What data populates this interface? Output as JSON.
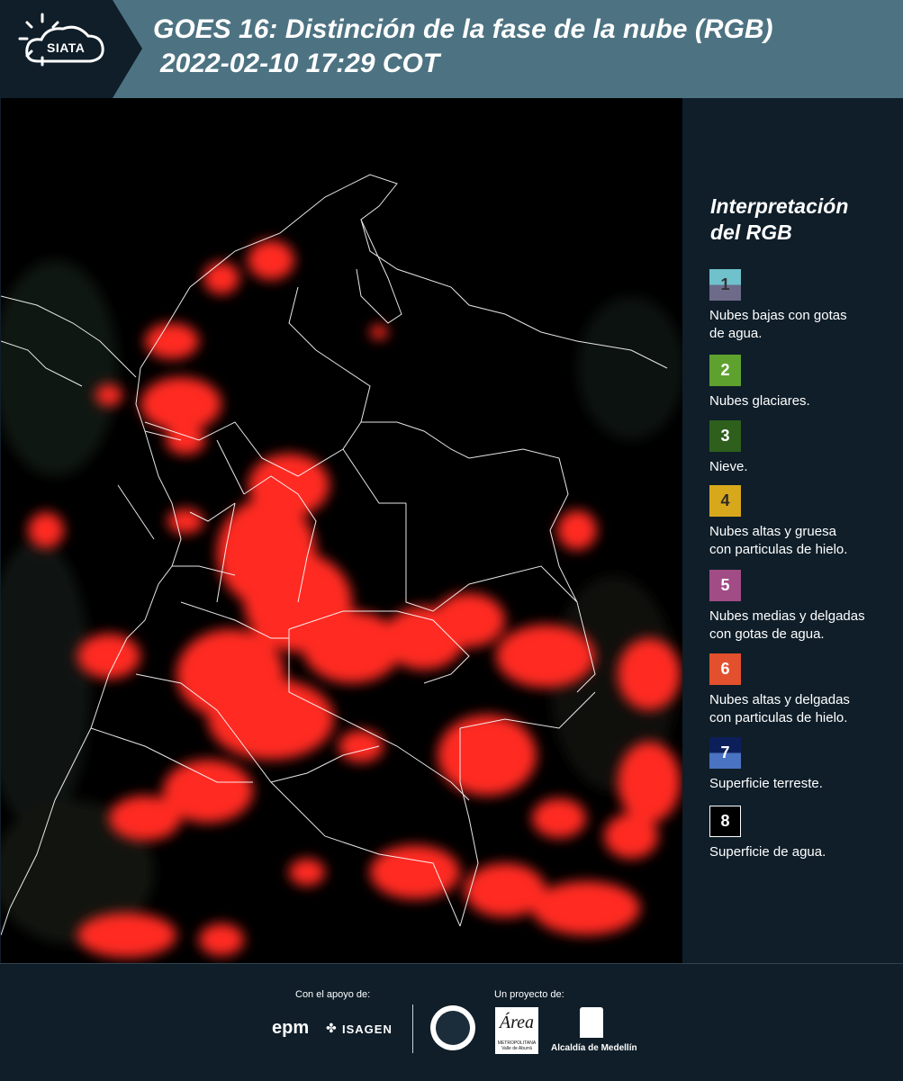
{
  "header": {
    "logo_text": "SIATA",
    "title_line1": "GOES 16: Distinción de la fase de la nube (RGB)",
    "title_line2": "2022-02-10 17:29 COT",
    "background_color": "#4d7382"
  },
  "legend": {
    "title_line1": "Interpretación",
    "title_line2": "del RGB",
    "items": [
      {
        "number": "1",
        "label_lines": [
          "Nubes bajas con gotas",
          "de agua."
        ],
        "colors": [
          "#6fc1cc",
          "#6e6a8a"
        ]
      },
      {
        "number": "2",
        "label_lines": [
          "Nubes glaciares."
        ],
        "colors": [
          "#5fa12e"
        ]
      },
      {
        "number": "3",
        "label_lines": [
          "Nieve."
        ],
        "colors": [
          "#2e5f1c"
        ]
      },
      {
        "number": "4",
        "label_lines": [
          "Nubes altas y gruesa",
          "con particulas de hielo."
        ],
        "colors": [
          "#d8a81c"
        ]
      },
      {
        "number": "5",
        "label_lines": [
          "Nubes medias y delgadas",
          "con gotas de agua."
        ],
        "colors": [
          "#a24c86"
        ]
      },
      {
        "number": "6",
        "label_lines": [
          "Nubes altas y delgadas",
          "con particulas de hielo."
        ],
        "colors": [
          "#e2502e"
        ]
      },
      {
        "number": "7",
        "label_lines": [
          "Superficie terreste."
        ],
        "colors": [
          "#0d1f5a",
          "#4a73c2"
        ]
      },
      {
        "number": "8",
        "label_lines": [
          "Superficie de agua."
        ],
        "colors": [
          "#000000"
        ]
      }
    ]
  },
  "footer": {
    "support_label": "Con el apoyo de:",
    "project_label": "Un proyecto de:",
    "sponsor1": "epm",
    "sponsor2": "ISAGEN",
    "partner_area": "Área",
    "partner_area_sub1": "METROPOLITANA",
    "partner_area_sub2": "Valle de Aburrá",
    "partner_alcaldia": "Alcaldía de Medellín"
  },
  "map": {
    "cloud_color": "#ff2a22",
    "background_color": "#000000",
    "border_color": "#ffffff"
  }
}
